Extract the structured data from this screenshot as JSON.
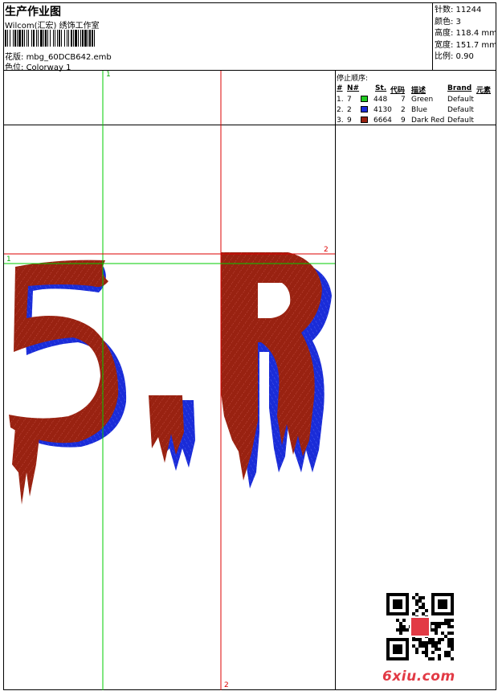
{
  "header": {
    "title": "生产作业图",
    "company": "Wilcom(汇宏) 绣饰工作室",
    "design_label": "花版:",
    "design_file": "mbg_60DCB642.emb",
    "colorway_label": "色位:",
    "colorway": "Colorway 1"
  },
  "stats": {
    "stitches": "针数: 11244",
    "colors": "颜色: 3",
    "height": "高度: 118.4 mm",
    "width": "宽度: 151.7 mm",
    "scale": "比例: 0.90"
  },
  "stop_sequence": {
    "title": "停止顺序:",
    "headers": {
      "num": "#",
      "needle": "N#",
      "stitches": "St.",
      "code": "代码",
      "desc": "描述",
      "brand": "Brand",
      "element": "元素"
    },
    "rows": [
      {
        "num": "1.",
        "needle": "7",
        "swatch": "#22cc22",
        "stitches": "448",
        "code": "7",
        "desc": "Green",
        "brand": "Default"
      },
      {
        "num": "2.",
        "needle": "2",
        "swatch": "#1a2cd8",
        "stitches": "4130",
        "code": "2",
        "desc": "Blue",
        "brand": "Default"
      },
      {
        "num": "3.",
        "needle": "9",
        "swatch": "#992211",
        "stitches": "6664",
        "code": "9",
        "desc": "Dark Red",
        "brand": "Default"
      }
    ]
  },
  "guides": {
    "v1_label": "1",
    "v2_label": "2",
    "h1_label": "1",
    "h2_label": "2",
    "green": "#00cc00",
    "red": "#dd0000"
  },
  "design": {
    "text": "5.R",
    "fill_color": "#992211",
    "shadow_color": "#1a2cd8"
  },
  "watermark": {
    "site": "6xiu.com",
    "color": "#e23a45"
  }
}
